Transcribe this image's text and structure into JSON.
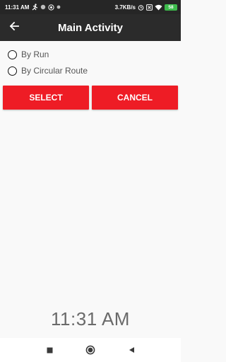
{
  "status_bar": {
    "time": "11:31 AM",
    "network_speed": "3.7KB/s",
    "battery_level": "58",
    "icons_left": [
      "running-icon",
      "dot-icon",
      "location-icon",
      "dot-icon"
    ],
    "icons_right": [
      "alarm-icon",
      "close-box-icon",
      "wifi-icon",
      "battery-icon"
    ]
  },
  "app_bar": {
    "title": "Main Activity",
    "back_icon": "arrow-left-icon"
  },
  "options": [
    {
      "label": "By Run",
      "selected": false
    },
    {
      "label": "By Circular Route",
      "selected": false
    }
  ],
  "buttons": {
    "select": "SELECT",
    "cancel": "CANCEL"
  },
  "clock_text": "11:31 AM",
  "colors": {
    "accent": "#ee1c25",
    "app_bar": "#2b2b2b",
    "status_bar": "#262626",
    "background": "#f9f9f9",
    "battery": "#3dbb4c"
  },
  "nav_bar": {
    "icons": [
      "recent-apps-icon",
      "home-icon",
      "back-triangle-icon"
    ]
  }
}
